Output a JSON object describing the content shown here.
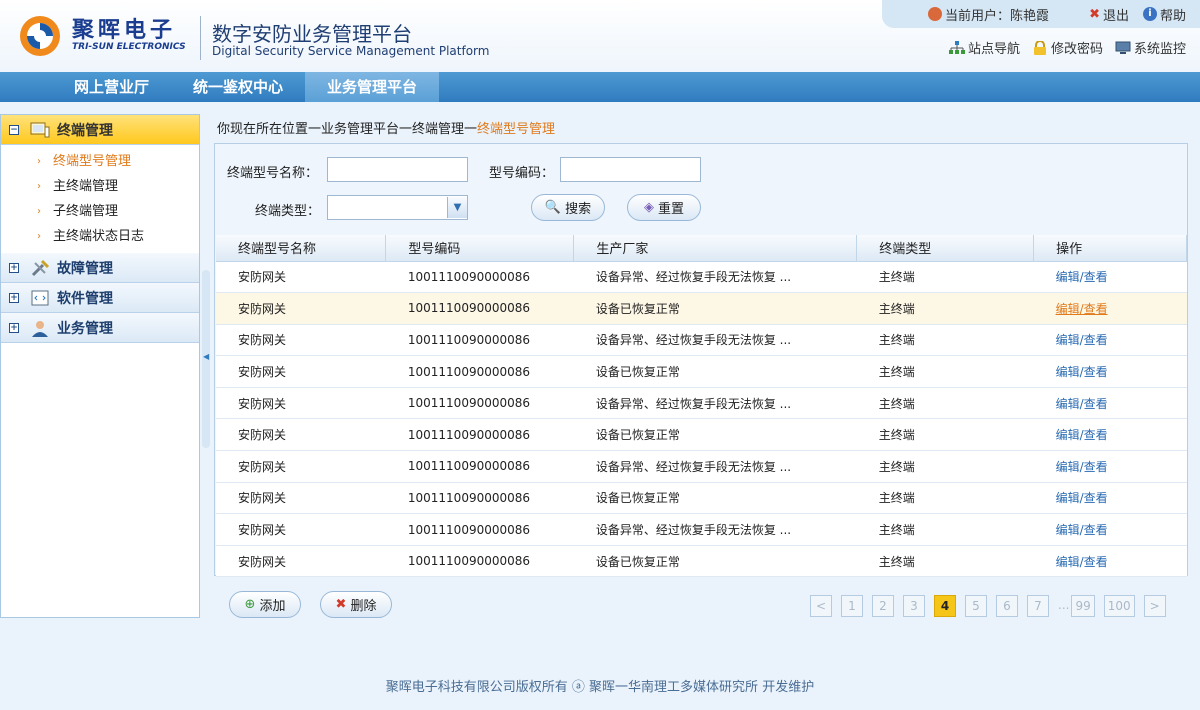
{
  "header": {
    "brand_cn": "聚晖电子",
    "brand_en": "TRI-SUN ELECTRONICS",
    "platform_cn": "数字安防业务管理平台",
    "platform_en": "Digital Security Service Management Platform",
    "current_user": "当前用户：陈艳霞",
    "logout": "退出",
    "help": "帮助",
    "quicklinks": [
      "站点导航",
      "修改密码",
      "系统监控"
    ]
  },
  "nav": {
    "tabs": [
      "网上营业厅",
      "统一鉴权中心",
      "业务管理平台"
    ],
    "active_index": 2
  },
  "sidebar": {
    "groups": [
      {
        "label": "终端管理",
        "icon": "terminal-icon",
        "expanded": true,
        "items": [
          "终端型号管理",
          "主终端管理",
          "子终端管理",
          "主终端状态日志"
        ],
        "active_item": 0
      },
      {
        "label": "故障管理",
        "icon": "tools-icon",
        "expanded": false
      },
      {
        "label": "软件管理",
        "icon": "software-icon",
        "expanded": false
      },
      {
        "label": "业务管理",
        "icon": "user-icon",
        "expanded": false
      }
    ]
  },
  "breadcrumb": {
    "prefix": "你现在所在位置一业务管理平台一终端管理一",
    "current": "终端型号管理"
  },
  "search": {
    "name_label": "终端型号名称：",
    "name_value": "",
    "code_label": "型号编码：",
    "code_value": "",
    "type_label": "终端类型：",
    "type_value": "",
    "search_button": "搜索",
    "reset_button": "重置"
  },
  "table": {
    "columns": [
      "终端型号名称",
      "型号编码",
      "生产厂家",
      "终端类型",
      "操作"
    ],
    "rows": [
      [
        "安防网关",
        "1001110090000086",
        "设备异常、经过恢复手段无法恢复 ...",
        "主终端",
        "编辑/查看"
      ],
      [
        "安防网关",
        "1001110090000086",
        "设备已恢复正常",
        "主终端",
        "编辑/查看"
      ],
      [
        "安防网关",
        "1001110090000086",
        "设备异常、经过恢复手段无法恢复 ...",
        "主终端",
        "编辑/查看"
      ],
      [
        "安防网关",
        "1001110090000086",
        "设备已恢复正常",
        "主终端",
        "编辑/查看"
      ],
      [
        "安防网关",
        "1001110090000086",
        "设备异常、经过恢复手段无法恢复 ...",
        "主终端",
        "编辑/查看"
      ],
      [
        "安防网关",
        "1001110090000086",
        "设备已恢复正常",
        "主终端",
        "编辑/查看"
      ],
      [
        "安防网关",
        "1001110090000086",
        "设备异常、经过恢复手段无法恢复 ...",
        "主终端",
        "编辑/查看"
      ],
      [
        "安防网关",
        "1001110090000086",
        "设备已恢复正常",
        "主终端",
        "编辑/查看"
      ],
      [
        "安防网关",
        "1001110090000086",
        "设备异常、经过恢复手段无法恢复 ...",
        "主终端",
        "编辑/查看"
      ],
      [
        "安防网关",
        "1001110090000086",
        "设备已恢复正常",
        "主终端",
        "编辑/查看"
      ]
    ],
    "highlighted_row": 1
  },
  "actions": {
    "add": "添加",
    "delete": "删除"
  },
  "pager": {
    "prev": "<",
    "pages": [
      "1",
      "2",
      "3",
      "4",
      "5",
      "6",
      "7"
    ],
    "current": "4",
    "ellipsis": "...",
    "tail": [
      "99",
      "100"
    ],
    "next": ">"
  },
  "footer": {
    "text": "聚晖电子科技有限公司版权所有 ⓐ 聚晖一华南理工多媒体研究所 开发维护"
  },
  "colors": {
    "accent": "#2f7bbf",
    "highlight": "#e07a1a",
    "active_menu": "#ffc81e"
  }
}
